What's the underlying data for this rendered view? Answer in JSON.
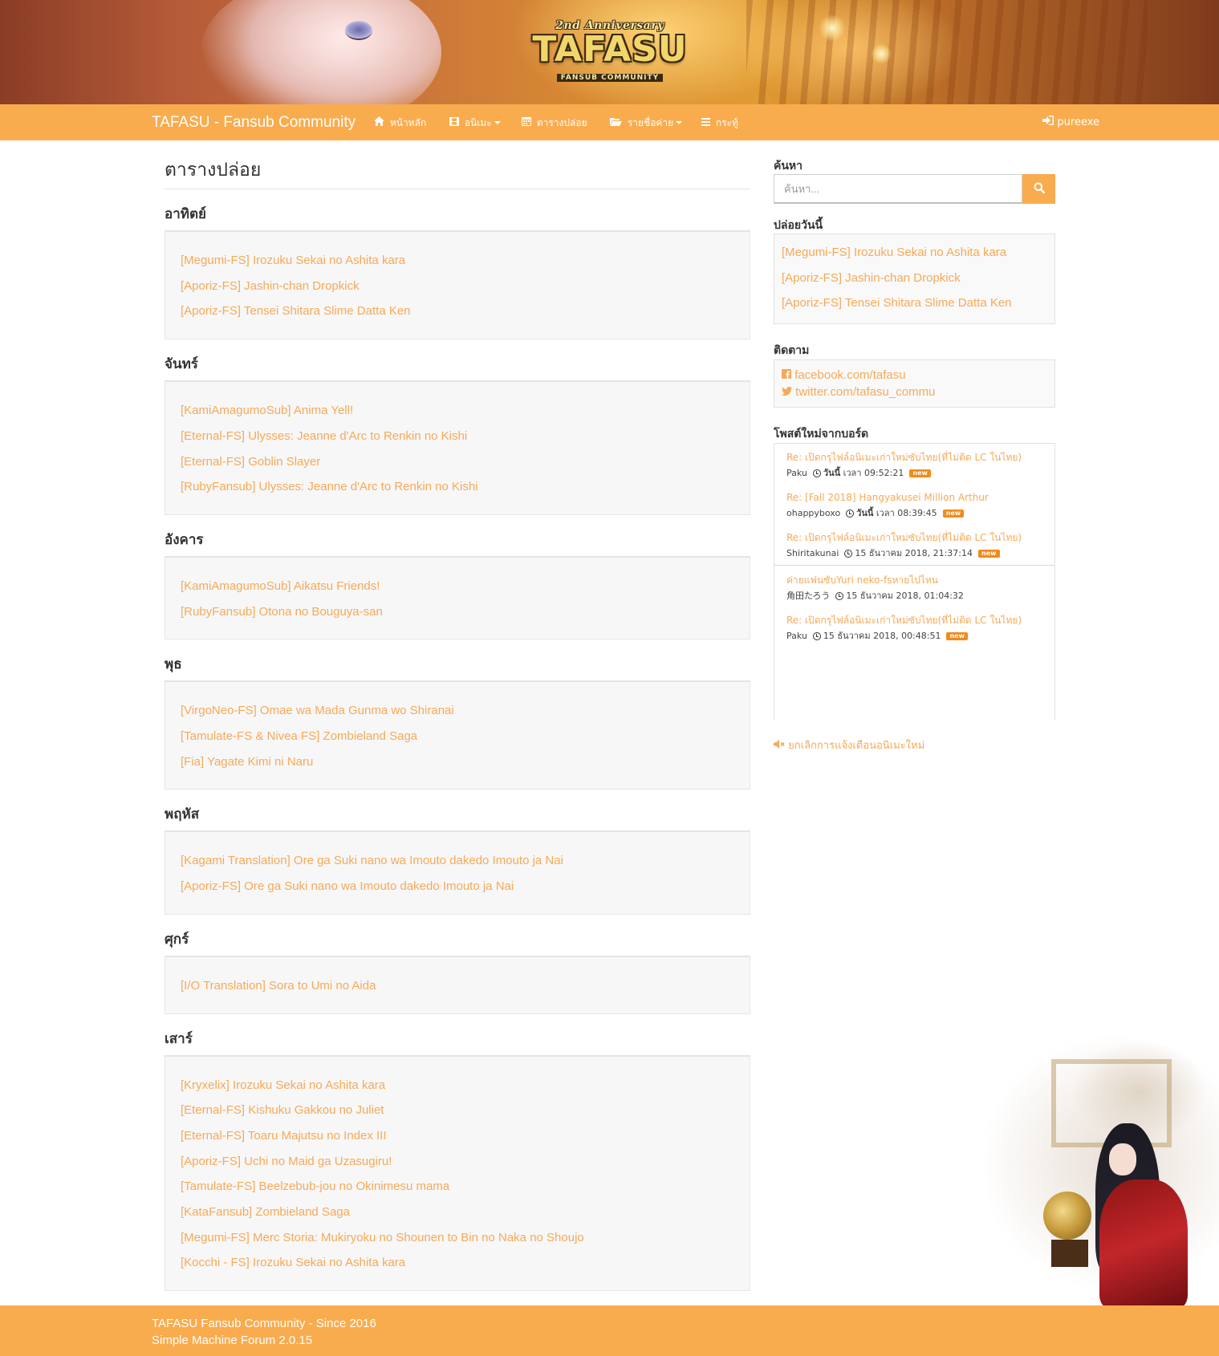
{
  "banner": {
    "logo_top": "2nd Anniversary",
    "logo_main": "TAFASU",
    "logo_sub": "FANSUB COMMUNITY"
  },
  "navbar": {
    "brand": "TAFASU - Fansub Community",
    "items": [
      {
        "label": "หน้าหลัก",
        "icon": "home-icon"
      },
      {
        "label": "อนิเมะ",
        "icon": "film-icon",
        "dropdown": true
      },
      {
        "label": "ตารางปล่อย",
        "icon": "calendar-icon"
      },
      {
        "label": "รายชื่อค่าย",
        "icon": "folder-open-icon",
        "dropdown": true
      },
      {
        "label": "กระทู้",
        "icon": "list-icon"
      }
    ],
    "user": "pureexe"
  },
  "main": {
    "title": "ตารางปล่อย",
    "days": [
      {
        "name": "อาทิตย์",
        "items": [
          "[Megumi-FS] Irozuku Sekai no Ashita kara",
          "[Aporiz-FS] Jashin-chan Dropkick",
          "[Aporiz-FS] Tensei Shitara Slime Datta Ken"
        ]
      },
      {
        "name": "จันทร์",
        "items": [
          "[KamiAmagumoSub] Anima Yell!",
          "[Eternal-FS] Ulysses: Jeanne d'Arc to Renkin no Kishi",
          "[Eternal-FS] Goblin Slayer",
          "[RubyFansub] Ulysses: Jeanne d'Arc to Renkin no Kishi"
        ]
      },
      {
        "name": "อังคาร",
        "items": [
          "[KamiAmagumoSub] Aikatsu Friends!",
          "[RubyFansub] Otona no Bouguya-san"
        ]
      },
      {
        "name": "พุธ",
        "items": [
          "[VirgoNeo-FS] Omae wa Mada Gunma wo Shiranai",
          "[Tamulate-FS & Nivea FS] Zombieland Saga",
          "[Fia] Yagate Kimi ni Naru"
        ]
      },
      {
        "name": "พฤหัส",
        "items": [
          "[Kagami Translation] Ore ga Suki nano wa Imouto dakedo Imouto ja Nai",
          "[Aporiz-FS] Ore ga Suki nano wa Imouto dakedo Imouto ja Nai"
        ]
      },
      {
        "name": "ศุกร์",
        "items": [
          "[I/O Translation] Sora to Umi no Aida"
        ]
      },
      {
        "name": "เสาร์",
        "items": [
          "[Kryxelix] Irozuku Sekai no Ashita kara",
          "[Eternal-FS] Kishuku Gakkou no Juliet",
          "[Eternal-FS] Toaru Majutsu no Index III",
          "[Aporiz-FS] Uchi no Maid ga Uzasugiru!",
          "[Tamulate-FS] Beelzebub-jou no Okinimesu mama",
          "[KataFansub] Zombieland Saga",
          "[Megumi-FS] Merc Storia: Mukiryoku no Shounen to Bin no Naka no Shoujo",
          "[Kocchi - FS] Irozuku Sekai no Ashita kara"
        ]
      }
    ]
  },
  "sidebar": {
    "search_heading": "ค้นหา",
    "search_placeholder": "ค้นหา...",
    "today_heading": "ปล่อยวันนี้",
    "today_items": [
      "[Megumi-FS] Irozuku Sekai no Ashita kara",
      "[Aporiz-FS] Jashin-chan Dropkick",
      "[Aporiz-FS] Tensei Shitara Slime Datta Ken"
    ],
    "follow_heading": "ติดตาม",
    "follow_links": [
      {
        "label": "facebook.com/tafasu",
        "icon": "facebook-icon"
      },
      {
        "label": "twitter.com/tafasu_commu",
        "icon": "twitter-icon"
      }
    ],
    "posts_heading": "โพสต์ใหม่จากบอร์ด",
    "posts": [
      {
        "title": "Re: เปิดกรุไฟล์อนิเมะเก่าใหม่ซับไทย(ที่ไม่ติด LC ในไทย)",
        "author": "Paku",
        "date_bold": "วันนี้",
        "time": "เวลา 09:52:21",
        "new": "new"
      },
      {
        "title": "Re: [Fall 2018] Hangyakusei Million Arthur",
        "author": "ohappyboxo",
        "date_bold": "วันนี้",
        "time": "เวลา 08:39:45",
        "new": "new"
      },
      {
        "title": "Re: เปิดกรุไฟล์อนิเมะเก่าใหม่ซับไทย(ที่ไม่ติด LC ในไทย)",
        "author": "Shiritakunai",
        "date_bold": "",
        "time": "15 ธันวาคม 2018, 21:37:14",
        "new": "new"
      },
      {
        "title": "ค่ายแฟนซับYuri neko-fsหายไปไหน",
        "author": "角田たろう",
        "date_bold": "",
        "time": "15 ธันวาคม 2018, 01:04:32",
        "new": ""
      },
      {
        "title": "Re: เปิดกรุไฟล์อนิเมะเก่าใหม่ซับไทย(ที่ไม่ติด LC ในไทย)",
        "author": "Paku",
        "date_bold": "",
        "time": "15 ธันวาคม 2018, 00:48:51",
        "new": "new"
      }
    ],
    "unsubscribe": "ยกเลิกการแจ้งเตือนอนิเมะใหม่"
  },
  "footer": {
    "line1": "TAFASU Fansub Community - Since 2016",
    "line2": "Simple Machine Forum 2.0.15"
  },
  "colors": {
    "accent": "#f9ac4e",
    "link": "#f7a957",
    "badge": "#f38a1a"
  }
}
